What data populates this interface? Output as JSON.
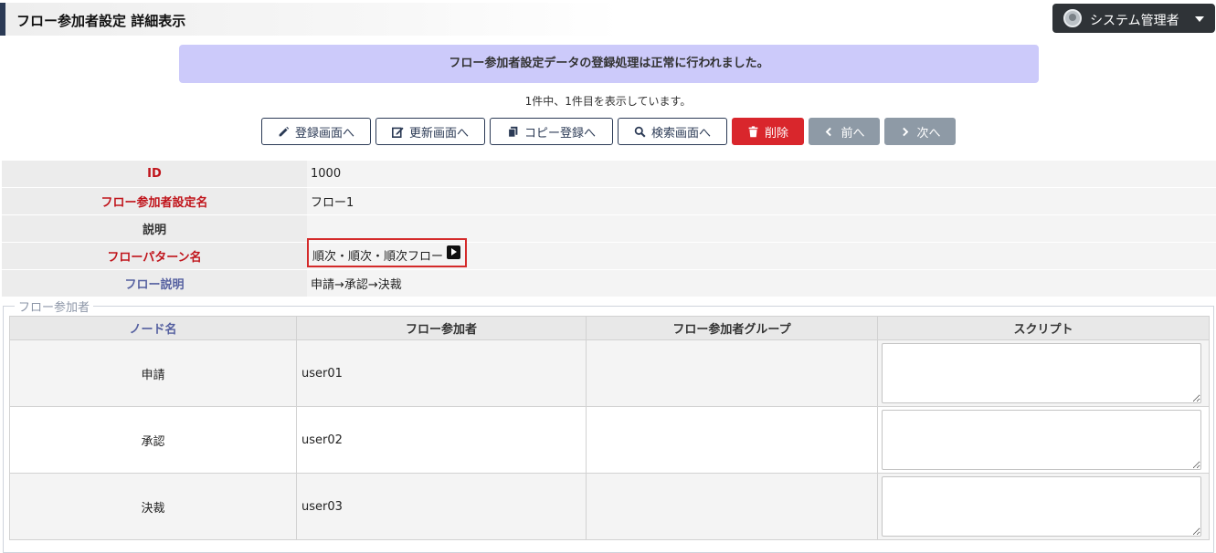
{
  "page": {
    "title": "フロー参加者設定 詳細表示"
  },
  "user_menu": {
    "label": "システム管理者",
    "icon": "user-avatar-icon"
  },
  "message": {
    "text": "フロー参加者設定データの登録処理は正常に行われました。"
  },
  "record_count": "1件中、1件目を表示しています。",
  "toolbar": {
    "register": {
      "label": "登録画面へ",
      "icon": "pencil-icon"
    },
    "update": {
      "label": "更新画面へ",
      "icon": "edit-icon"
    },
    "copy": {
      "label": "コピー登録へ",
      "icon": "copy-icon"
    },
    "search": {
      "label": "検索画面へ",
      "icon": "search-icon"
    },
    "delete": {
      "label": "削除",
      "icon": "trash-icon",
      "color": "#d9262c"
    },
    "prev": {
      "label": "前へ",
      "icon": "chevron-left-icon"
    },
    "next": {
      "label": "次へ",
      "icon": "chevron-right-icon"
    }
  },
  "detail": {
    "id": {
      "label": "ID",
      "value": "1000"
    },
    "name": {
      "label": "フロー参加者設定名",
      "value": "フロー1"
    },
    "description": {
      "label": "説明",
      "value": ""
    },
    "pattern": {
      "label": "フローパターン名",
      "value": "順次・順次・順次フロー",
      "icon": "play-icon"
    },
    "flow_description": {
      "label": "フロー説明",
      "value": "申請→承認→決裁"
    }
  },
  "participants": {
    "legend": "フロー参加者",
    "headers": [
      "ノード名",
      "フロー参加者",
      "フロー参加者グループ",
      "スクリプト"
    ],
    "rows": [
      {
        "node": "申請",
        "user": "user01",
        "group": "",
        "script": ""
      },
      {
        "node": "承認",
        "user": "user02",
        "group": "",
        "script": ""
      },
      {
        "node": "決裁",
        "user": "user03",
        "group": "",
        "script": ""
      }
    ]
  },
  "colors": {
    "accent": "#2b3a55",
    "message_bg": "#cccafa",
    "label_red": "#c0141b",
    "label_blue": "#5560a0",
    "highlight_border": "#d42a2a"
  }
}
